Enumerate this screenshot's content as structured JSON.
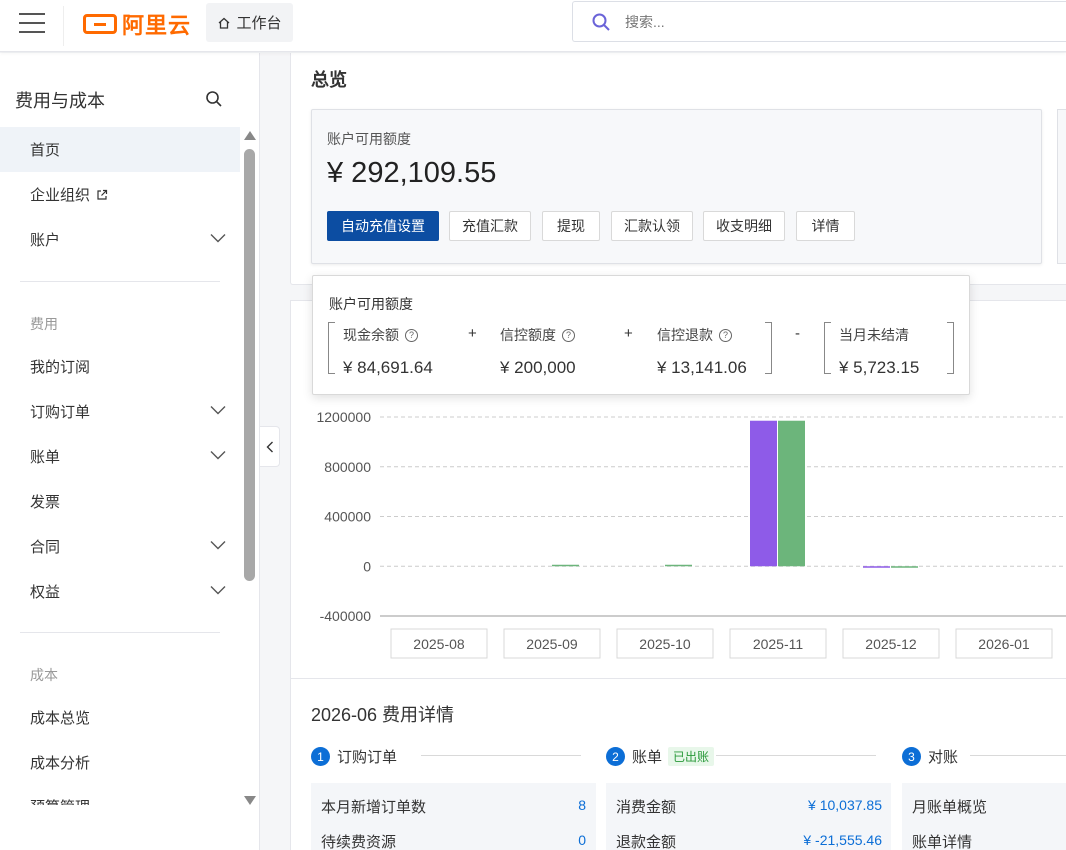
{
  "topbar": {
    "logo_text": "阿里云",
    "workbench_label": "工作台",
    "search_placeholder": "搜索..."
  },
  "sidebar": {
    "title": "费用与成本",
    "items": [
      {
        "label": "首页",
        "active": true
      },
      {
        "label": "企业组织"
      },
      {
        "label": "账户"
      }
    ],
    "section_fee": "费用",
    "fee_items": [
      {
        "label": "我的订阅"
      },
      {
        "label": "订购订单"
      },
      {
        "label": "账单"
      },
      {
        "label": "发票"
      },
      {
        "label": "合同"
      },
      {
        "label": "权益"
      }
    ],
    "section_cost": "成本",
    "cost_items": [
      {
        "label": "成本总览"
      },
      {
        "label": "成本分析"
      },
      {
        "label": "预算管理"
      }
    ]
  },
  "overview": {
    "title": "总览",
    "balance_label": "账户可用额度",
    "balance_amount": "¥ 292,109.55",
    "buttons": {
      "auto_recharge": "自动充值设置",
      "remit": "充值汇款",
      "withdraw": "提现",
      "remit_claim": "汇款认领",
      "statement": "收支明细",
      "details": "详情"
    }
  },
  "popover": {
    "title": "账户可用额度",
    "cash_label": "现金余额",
    "cash_value": "¥ 84,691.64",
    "credit_label": "信控额度",
    "credit_value": "¥ 200,000",
    "refund_label": "信控退款",
    "refund_value": "¥ 13,141.06",
    "unsettled_label": "当月未结清",
    "unsettled_value": "¥ 5,723.15",
    "plus": "+",
    "minus": "-"
  },
  "chart_data": {
    "type": "bar",
    "categories": [
      "2025-08",
      "2025-09",
      "2025-10",
      "2025-11",
      "2025-12",
      "2026-01"
    ],
    "yticks": [
      1200000,
      800000,
      400000,
      0,
      -400000
    ],
    "ylim": [
      -400000,
      1200000
    ],
    "grid": true,
    "series": [
      {
        "color": "#8e5be8",
        "values": [
          0,
          0,
          0,
          1170000,
          -12000,
          0
        ]
      },
      {
        "color": "#6cb57b",
        "values": [
          0,
          5000,
          5000,
          1170000,
          -12000,
          0
        ]
      }
    ]
  },
  "details": {
    "title": "2026-06 费用详情",
    "step1": {
      "num": "1",
      "label": "订购订单"
    },
    "step2": {
      "num": "2",
      "label": "账单",
      "badge": "已出账"
    },
    "step3": {
      "num": "3",
      "label": "对账"
    },
    "orders": [
      {
        "label": "本月新增订单数",
        "value": "8"
      },
      {
        "label": "待续费资源",
        "value": "0"
      }
    ],
    "bills": [
      {
        "label": "消费金额",
        "value": "¥ 10,037.85"
      },
      {
        "label": "退款金额",
        "value": "¥ -21,555.46"
      }
    ],
    "recon": [
      {
        "label": "月账单概览"
      },
      {
        "label": "账单详情"
      }
    ]
  },
  "colors": {
    "primary": "#0c4da2",
    "brand": "#ff6a00",
    "link": "#0c6ed6"
  }
}
